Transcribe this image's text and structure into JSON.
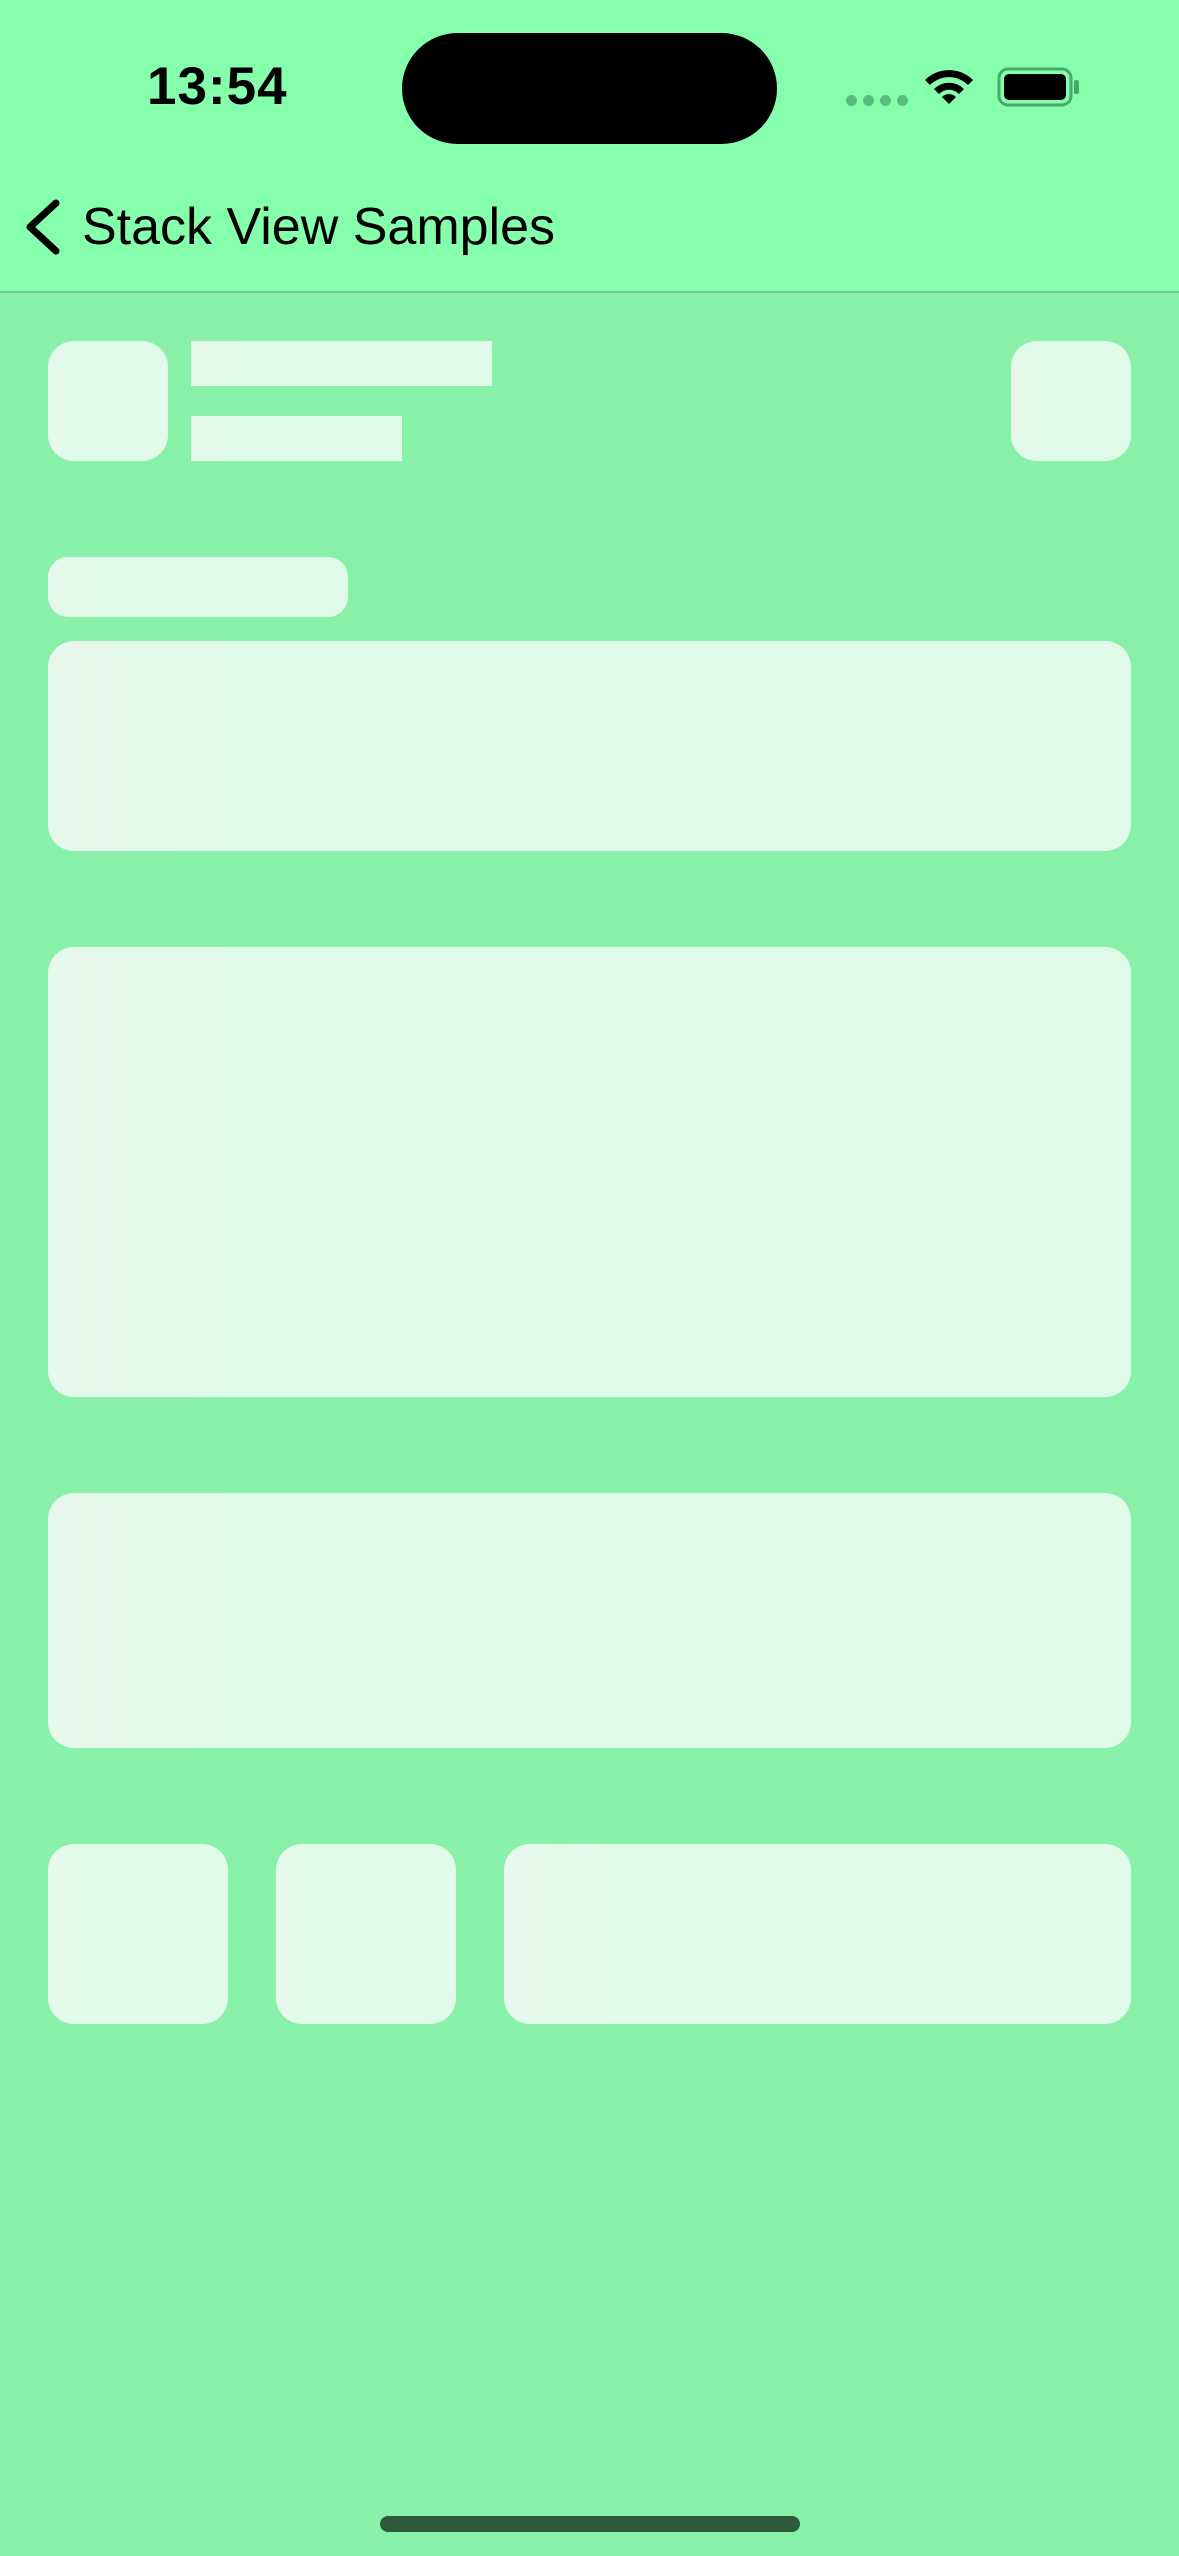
{
  "status_bar": {
    "time": "13:54"
  },
  "nav": {
    "back_icon": "chevron-left-icon",
    "title": "Stack View Samples"
  },
  "colors": {
    "header_bg": "#86ffad",
    "content_bg": "#88f0a9",
    "skeleton": "#e0fbea",
    "home_indicator": "#2f5a3b"
  }
}
